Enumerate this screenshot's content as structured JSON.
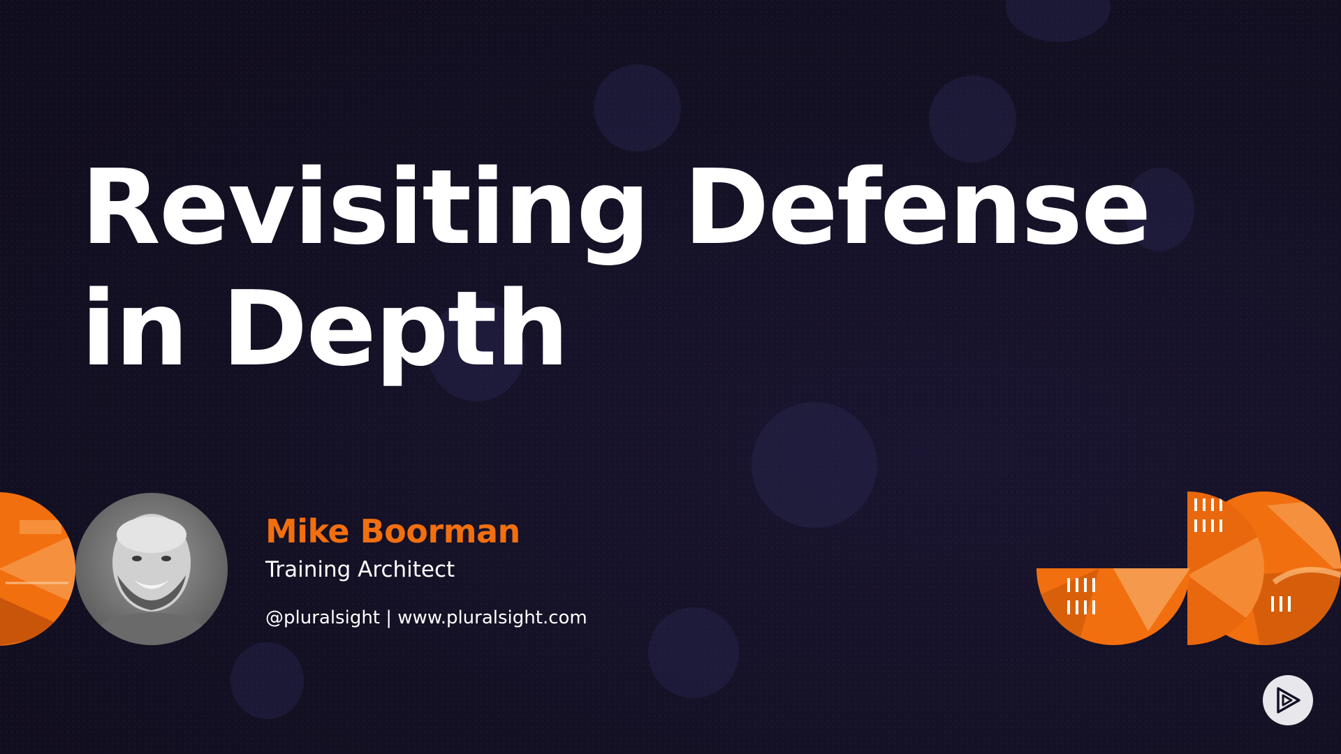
{
  "slide": {
    "title": "Revisiting Defense in Depth",
    "presenter": {
      "name": "Mike Boorman",
      "role": "Training Architect",
      "links": "@pluralsight | www.pluralsight.com"
    }
  },
  "brand": {
    "logo_icon": "pluralsight-play-icon",
    "accent_color": "#f26f0f",
    "background_color": "#131023"
  }
}
